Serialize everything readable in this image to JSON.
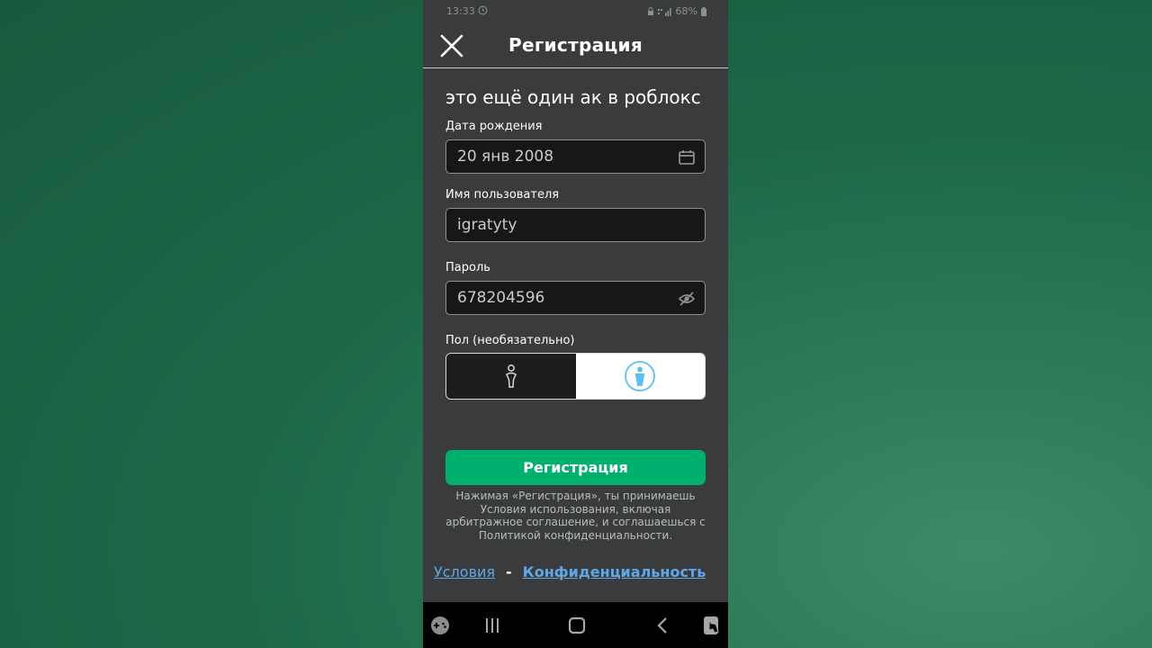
{
  "status_bar": {
    "time": "13:33",
    "battery": "68%"
  },
  "header": {
    "title": "Регистрация"
  },
  "overlay_caption": "это ещё один ак в роблокс",
  "form": {
    "birthdate": {
      "label": "Дата рождения",
      "value": "20 янв 2008"
    },
    "username": {
      "label": "Имя пользователя",
      "value": "igratyty"
    },
    "password": {
      "label": "Пароль",
      "value": "678204596"
    },
    "gender": {
      "label": "Пол (необязательно)",
      "selected": "male"
    },
    "submit_label": "Регистрация"
  },
  "legal": {
    "text": "Нажимая «Регистрация», ты принимаешь Условия использования, включая арбитражное соглашение, и соглашаешься с Политикой конфиденциальности.",
    "terms_link": "Условия",
    "separator": "-",
    "privacy_link": "Конфиденциальность"
  },
  "colors": {
    "accent": "#00b06f",
    "link": "#5fa8e8",
    "panel_bg": "#393b3d",
    "field_bg": "#151817",
    "male_icon": "#5bc0f8"
  },
  "icons": {
    "close": "close-icon",
    "calendar": "calendar-icon",
    "visibility": "eye-off-icon",
    "female": "female-icon",
    "male": "male-icon"
  }
}
